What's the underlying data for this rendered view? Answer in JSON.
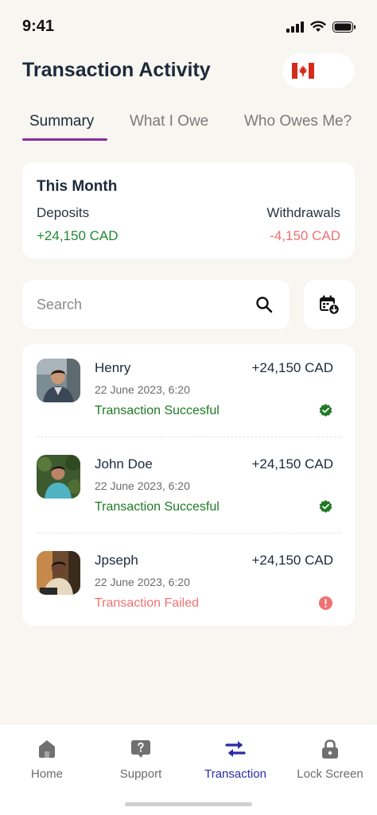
{
  "status_bar": {
    "time": "9:41"
  },
  "header": {
    "title": "Transaction Activity",
    "flag_icon": "canada-flag-icon"
  },
  "tabs": [
    {
      "label": "Summary",
      "active": true
    },
    {
      "label": "What I Owe",
      "active": false
    },
    {
      "label": "Who Owes Me?",
      "active": false
    }
  ],
  "summary": {
    "title": "This Month",
    "deposits_label": "Deposits",
    "withdrawals_label": "Withdrawals",
    "deposits_value": "+24,150 CAD",
    "withdrawals_value": "-4,150 CAD"
  },
  "search": {
    "placeholder": "Search",
    "value": ""
  },
  "transactions": [
    {
      "name": "Henry",
      "amount": "+24,150 CAD",
      "date": "22 June 2023, 6:20",
      "status": "Transaction Succesful",
      "state": "success"
    },
    {
      "name": "John Doe",
      "amount": "+24,150 CAD",
      "date": "22 June 2023, 6:20",
      "status": "Transaction Succesful",
      "state": "success"
    },
    {
      "name": "Jpseph",
      "amount": "+24,150 CAD",
      "date": "22 June 2023, 6:20",
      "status": "Transaction Failed",
      "state": "failed"
    }
  ],
  "bottom_nav": [
    {
      "label": "Home",
      "icon": "home-icon",
      "active": false
    },
    {
      "label": "Support",
      "icon": "support-icon",
      "active": false
    },
    {
      "label": "Transaction",
      "icon": "transaction-icon",
      "active": true
    },
    {
      "label": "Lock Screen",
      "icon": "lock-icon",
      "active": false
    }
  ],
  "colors": {
    "accent": "#8b2aa0",
    "success": "#1f8a2e",
    "failed": "#ef7272",
    "nav_active": "#2a2aa6",
    "background": "#f8f6f1"
  }
}
